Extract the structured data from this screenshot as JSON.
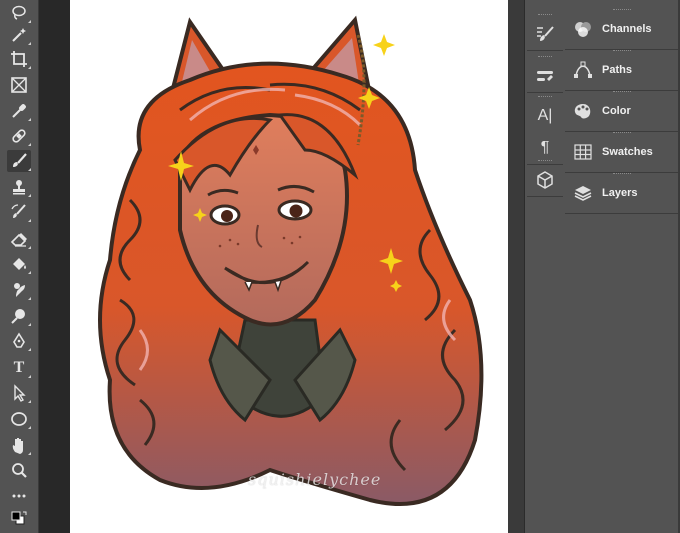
{
  "toolbar": {
    "tools": [
      {
        "name": "lasso-tool",
        "icon": "lasso-icon"
      },
      {
        "name": "magic-wand-tool",
        "icon": "magic-wand-icon"
      },
      {
        "name": "crop-tool",
        "icon": "crop-icon"
      },
      {
        "name": "frame-tool",
        "icon": "frame-icon"
      },
      {
        "name": "eyedropper-tool",
        "icon": "eyedropper-icon"
      },
      {
        "name": "healing-brush-tool",
        "icon": "bandage-icon"
      },
      {
        "name": "brush-tool",
        "icon": "brush-icon",
        "active": true
      },
      {
        "name": "clone-stamp-tool",
        "icon": "stamp-icon"
      },
      {
        "name": "history-brush-tool",
        "icon": "history-brush-icon"
      },
      {
        "name": "eraser-tool",
        "icon": "eraser-icon"
      },
      {
        "name": "paint-bucket-tool",
        "icon": "paint-bucket-icon"
      },
      {
        "name": "smudge-tool",
        "icon": "smudge-icon"
      },
      {
        "name": "dodge-tool",
        "icon": "dodge-icon"
      },
      {
        "name": "pen-tool",
        "icon": "pen-icon"
      },
      {
        "name": "type-tool",
        "icon": "type-icon",
        "glyph": "T"
      },
      {
        "name": "path-selection-tool",
        "icon": "arrow-icon"
      },
      {
        "name": "ellipse-tool",
        "icon": "ellipse-icon"
      },
      {
        "name": "hand-tool",
        "icon": "hand-icon"
      },
      {
        "name": "zoom-tool",
        "icon": "zoom-icon"
      },
      {
        "name": "more-tools",
        "icon": "ellipsis-icon"
      },
      {
        "name": "color-swatches",
        "icon": "fg-bg-color-icon"
      }
    ]
  },
  "document": {
    "watermark": "squishielychee",
    "artwork": "illustration-of-girl-with-cat-ears-and-curly-orange-hair"
  },
  "icon_column": {
    "groups": [
      {
        "items": [
          {
            "icon": "brush-settings-icon"
          }
        ]
      },
      {
        "items": [
          {
            "icon": "brush-presets-icon"
          }
        ]
      },
      {
        "items": [
          {
            "icon": "character-icon",
            "glyph": "A|"
          },
          {
            "icon": "paragraph-icon",
            "glyph": "¶"
          }
        ]
      },
      {
        "items": [
          {
            "icon": "3d-cube-icon"
          }
        ]
      }
    ]
  },
  "panels": {
    "items": [
      {
        "label": "Channels",
        "icon": "channels-icon"
      },
      {
        "label": "Paths",
        "icon": "paths-icon"
      },
      {
        "label": "Color",
        "icon": "color-palette-icon"
      },
      {
        "label": "Swatches",
        "icon": "swatches-grid-icon"
      },
      {
        "label": "Layers",
        "icon": "layers-icon"
      }
    ]
  },
  "colors": {
    "ui_bg": "#535353",
    "pasteboard": "#282828",
    "hair": "#e2551f",
    "hair_shadow": "#8a5a66",
    "sparkle": "#f7d21a"
  }
}
